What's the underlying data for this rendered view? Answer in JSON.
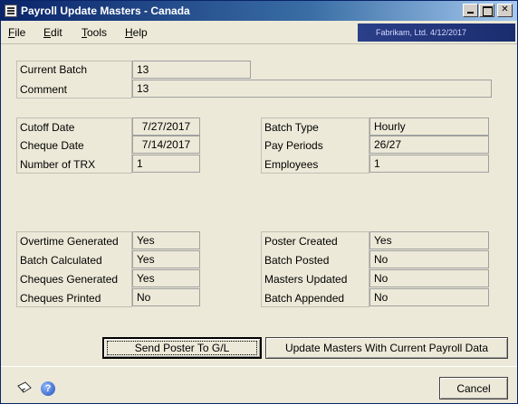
{
  "window": {
    "title": "Payroll Update Masters - Canada",
    "company_banner": "Fabrikam, Ltd.   4/12/2017"
  },
  "menu": {
    "file": {
      "label": "File",
      "accel": "F"
    },
    "edit": {
      "label": "Edit",
      "accel": "E"
    },
    "tools": {
      "label": "Tools",
      "accel": "T"
    },
    "help": {
      "label": "Help",
      "accel": "H"
    }
  },
  "batch": {
    "current_batch_label": "Current Batch",
    "current_batch_value": "13",
    "comment_label": "Comment",
    "comment_value": "13"
  },
  "dates": {
    "cutoff_date_label": "Cutoff Date",
    "cutoff_date_value": "7/27/2017",
    "cheque_date_label": "Cheque Date",
    "cheque_date_value": "7/14/2017",
    "number_trx_label": "Number of TRX",
    "number_trx_value": "1",
    "batch_type_label": "Batch Type",
    "batch_type_value": "Hourly",
    "pay_periods_label": "Pay Periods",
    "pay_periods_value": "26/27",
    "employees_label": "Employees",
    "employees_value": "1"
  },
  "status_left": [
    {
      "label": "Overtime Generated",
      "value": "Yes"
    },
    {
      "label": "Batch Calculated",
      "value": "Yes"
    },
    {
      "label": "Cheques Generated",
      "value": "Yes"
    },
    {
      "label": "Cheques Printed",
      "value": "No"
    }
  ],
  "status_right": [
    {
      "label": "Poster Created",
      "value": "Yes"
    },
    {
      "label": "Batch Posted",
      "value": "No"
    },
    {
      "label": "Masters Updated",
      "value": "No"
    },
    {
      "label": "Batch Appended",
      "value": "No"
    }
  ],
  "buttons": {
    "send_poster": "Send Poster To G/L",
    "update_masters": "Update Masters With Current Payroll Data",
    "cancel": "Cancel"
  },
  "icons": {
    "note": "note-icon",
    "help": "help-icon"
  }
}
